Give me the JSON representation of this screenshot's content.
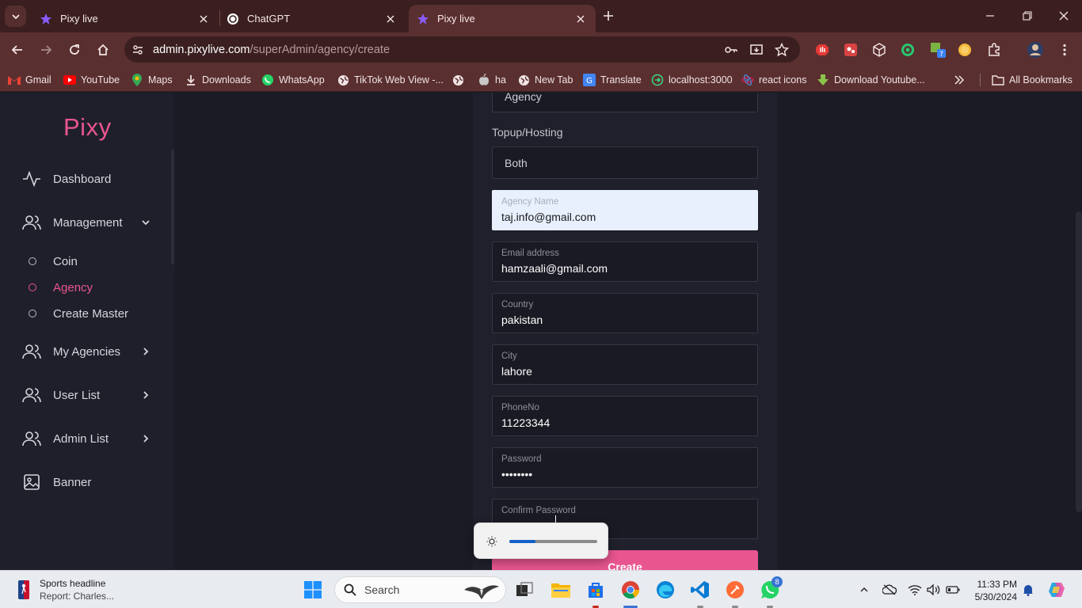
{
  "browser": {
    "tabs": [
      {
        "title": "Pixy live",
        "active": false
      },
      {
        "title": "ChatGPT",
        "active": false
      },
      {
        "title": "Pixy live",
        "active": true
      }
    ],
    "url_host": "admin.pixylive.com",
    "url_path": "/superAdmin/agency/create",
    "bookmarks": [
      {
        "label": "Gmail",
        "icon": "gmail-icon"
      },
      {
        "label": "YouTube",
        "icon": "youtube-icon"
      },
      {
        "label": "Maps",
        "icon": "maps-icon"
      },
      {
        "label": "Downloads",
        "icon": "download-icon"
      },
      {
        "label": "WhatsApp",
        "icon": "whatsapp-icon"
      },
      {
        "label": "TikTok Web View -...",
        "icon": "globe-icon"
      },
      {
        "label": "",
        "icon": "globe-icon"
      },
      {
        "label": "ha",
        "icon": "apple-icon"
      },
      {
        "label": "New Tab",
        "icon": "globe-icon"
      },
      {
        "label": "Translate",
        "icon": "translate-icon"
      },
      {
        "label": "localhost:3000",
        "icon": "localhost-icon"
      },
      {
        "label": "react icons",
        "icon": "react-icon"
      },
      {
        "label": "Download Youtube...",
        "icon": "download-arrow-icon"
      }
    ],
    "all_bookmarks": "All Bookmarks"
  },
  "sidebar": {
    "logo": "Pixy",
    "items": [
      {
        "label": "Dashboard",
        "icon": "activity-icon"
      },
      {
        "label": "Management",
        "icon": "users-icon",
        "chevron": "chevron-down-icon"
      },
      {
        "label": "My Agencies",
        "icon": "users-icon",
        "chevron": "chevron-right-icon"
      },
      {
        "label": "User List",
        "icon": "users-icon",
        "chevron": "chevron-right-icon"
      },
      {
        "label": "Admin List",
        "icon": "users-icon",
        "chevron": "chevron-right-icon"
      },
      {
        "label": "Banner",
        "icon": "image-icon"
      }
    ],
    "sub_items": [
      {
        "label": "Coin",
        "active": false
      },
      {
        "label": "Agency",
        "active": true
      },
      {
        "label": "Create Master",
        "active": false
      }
    ]
  },
  "form": {
    "agency_select": "Agency",
    "topup_label": "Topup/Hosting",
    "topup_select": "Both",
    "fields": [
      {
        "label": "Agency Name",
        "value": "taj.info@gmail.com"
      },
      {
        "label": "Email address",
        "value": "hamzaali@gmail.com"
      },
      {
        "label": "Country",
        "value": "pakistan"
      },
      {
        "label": "City",
        "value": "lahore"
      },
      {
        "label": "PhoneNo",
        "value": "11223344"
      },
      {
        "label": "Password",
        "value": "••••••••"
      },
      {
        "label": "Confirm Password",
        "value": ""
      }
    ],
    "submit_label": "Create"
  },
  "brightness": {
    "level": 0.3
  },
  "taskbar": {
    "widget_title": "Sports headline",
    "widget_sub": "Report: Charles...",
    "search_placeholder": "Search",
    "whatsapp_badge": "8",
    "time": "11:33 PM",
    "date": "5/30/2024"
  },
  "colors": {
    "accent": "#e8558f",
    "focused_field": "#e8f0fe",
    "chrome": "#5a2f30"
  }
}
